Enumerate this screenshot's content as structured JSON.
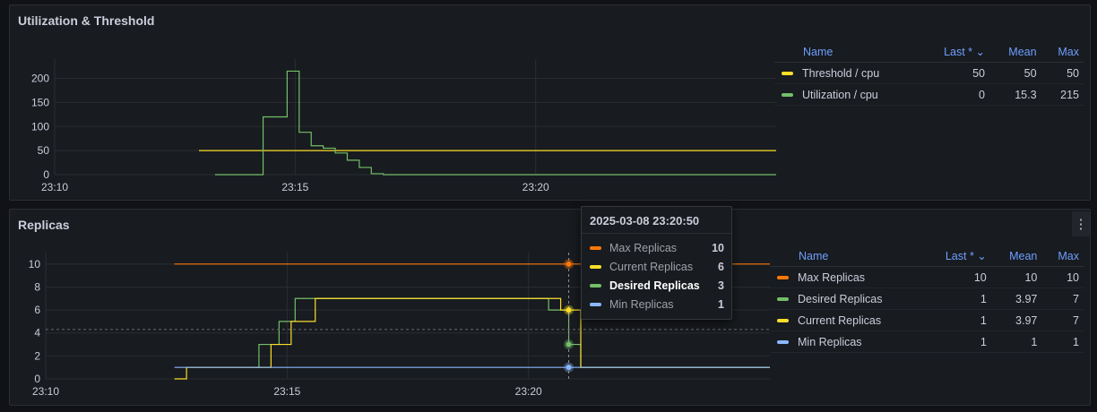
{
  "panels": {
    "util": {
      "title": "Utilization & Threshold"
    },
    "replicas": {
      "title": "Replicas",
      "menu_icon": "kebab-menu-icon"
    }
  },
  "legend_util": {
    "headers": {
      "name": "Name",
      "last": "Last * ⌄",
      "mean": "Mean",
      "max": "Max"
    },
    "rows": [
      {
        "name": "Threshold / cpu",
        "color": "#fade2a",
        "last": "50",
        "mean": "50",
        "max": "50"
      },
      {
        "name": "Utilization / cpu",
        "color": "#73bf69",
        "last": "0",
        "mean": "15.3",
        "max": "215"
      }
    ]
  },
  "legend_replicas": {
    "headers": {
      "name": "Name",
      "last": "Last * ⌄",
      "mean": "Mean",
      "max": "Max"
    },
    "rows": [
      {
        "name": "Max Replicas",
        "color": "#ff780a",
        "last": "10",
        "mean": "10",
        "max": "10"
      },
      {
        "name": "Desired Replicas",
        "color": "#73bf69",
        "last": "1",
        "mean": "3.97",
        "max": "7"
      },
      {
        "name": "Current Replicas",
        "color": "#fade2a",
        "last": "1",
        "mean": "3.97",
        "max": "7"
      },
      {
        "name": "Min Replicas",
        "color": "#8ab8ff",
        "last": "1",
        "mean": "1",
        "max": "1"
      }
    ]
  },
  "tooltip": {
    "time": "2025-03-08 23:20:50",
    "rows": [
      {
        "label": "Max Replicas",
        "value": "10",
        "color": "#ff780a",
        "highlight": false
      },
      {
        "label": "Current Replicas",
        "value": "6",
        "color": "#fade2a",
        "highlight": false
      },
      {
        "label": "Desired Replicas",
        "value": "3",
        "color": "#73bf69",
        "highlight": true
      },
      {
        "label": "Min Replicas",
        "value": "1",
        "color": "#8ab8ff",
        "highlight": false
      }
    ]
  },
  "chart_data": [
    {
      "type": "line",
      "title": "Utilization & Threshold",
      "x_range": [
        "23:10",
        "23:25"
      ],
      "x_ticks": [
        "23:10",
        "23:15",
        "23:20"
      ],
      "ylim": [
        0,
        240
      ],
      "y_ticks": [
        0,
        50,
        100,
        150,
        200
      ],
      "grid": true,
      "legend_placement": "right",
      "series": [
        {
          "name": "Threshold / cpu",
          "color": "#fade2a",
          "step": false,
          "points": [
            [
              "23:13:00",
              50
            ],
            [
              "23:25:00",
              50
            ]
          ]
        },
        {
          "name": "Utilization / cpu",
          "color": "#73bf69",
          "step": true,
          "points": [
            [
              "23:13:20",
              0
            ],
            [
              "23:14:20",
              120
            ],
            [
              "23:14:50",
              215
            ],
            [
              "23:15:05",
              88
            ],
            [
              "23:15:20",
              60
            ],
            [
              "23:15:35",
              55
            ],
            [
              "23:15:50",
              45
            ],
            [
              "23:16:05",
              30
            ],
            [
              "23:16:20",
              15
            ],
            [
              "23:16:35",
              2
            ],
            [
              "23:16:50",
              0
            ],
            [
              "23:25:00",
              0
            ]
          ]
        }
      ]
    },
    {
      "type": "line",
      "title": "Replicas",
      "x_range": [
        "23:10",
        "23:25"
      ],
      "x_ticks": [
        "23:10",
        "23:15",
        "23:20"
      ],
      "ylim": [
        0,
        11
      ],
      "y_ticks": [
        0,
        2,
        4,
        6,
        8,
        10
      ],
      "grid": true,
      "legend_placement": "right",
      "hover_time": "23:20:50",
      "series": [
        {
          "name": "Max Replicas",
          "color": "#ff780a",
          "step": true,
          "points": [
            [
              "23:12:40",
              10
            ],
            [
              "23:25:00",
              10
            ]
          ]
        },
        {
          "name": "Desired Replicas",
          "color": "#73bf69",
          "step": true,
          "points": [
            [
              "23:14:20",
              1
            ],
            [
              "23:14:25",
              3
            ],
            [
              "23:14:50",
              5
            ],
            [
              "23:15:10",
              7
            ],
            [
              "23:20:25",
              6
            ],
            [
              "23:20:50",
              3
            ],
            [
              "23:21:05",
              1
            ],
            [
              "23:25:00",
              1
            ]
          ]
        },
        {
          "name": "Current Replicas",
          "color": "#fade2a",
          "step": true,
          "points": [
            [
              "23:12:40",
              0
            ],
            [
              "23:12:55",
              1
            ],
            [
              "23:14:40",
              3
            ],
            [
              "23:15:05",
              5
            ],
            [
              "23:15:35",
              7
            ],
            [
              "23:20:40",
              6
            ],
            [
              "23:21:05",
              1
            ],
            [
              "23:25:00",
              1
            ]
          ]
        },
        {
          "name": "Min Replicas",
          "color": "#8ab8ff",
          "step": true,
          "points": [
            [
              "23:12:40",
              1
            ],
            [
              "23:25:00",
              1
            ]
          ]
        }
      ]
    }
  ]
}
